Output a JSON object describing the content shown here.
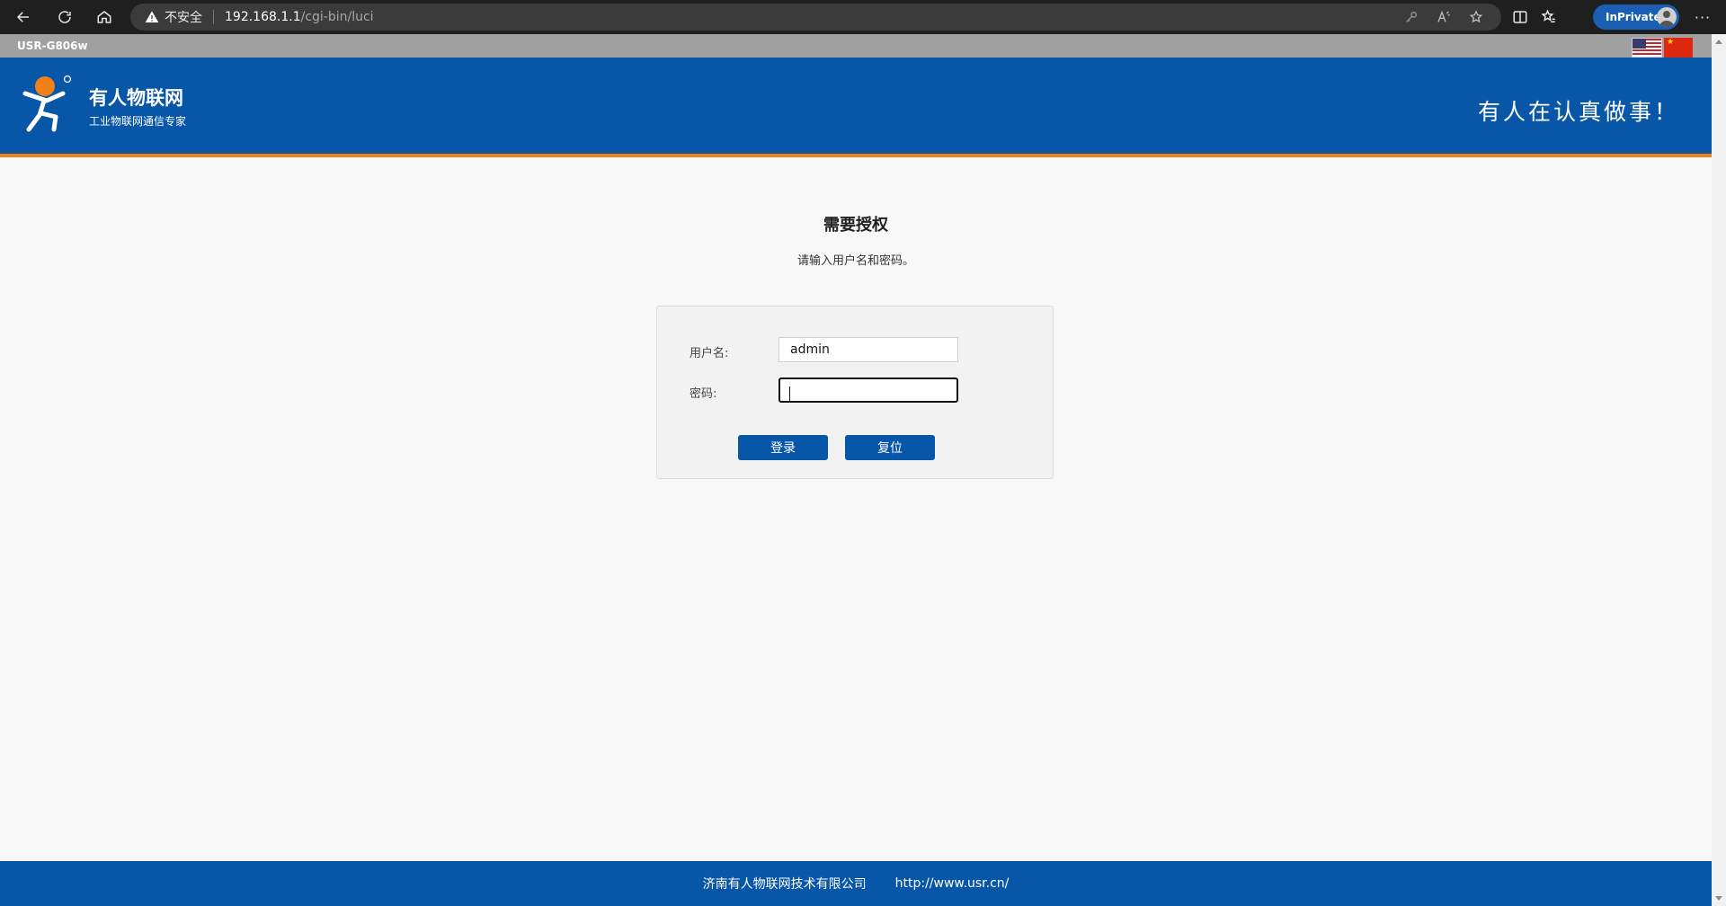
{
  "browser": {
    "security_label": "不安全",
    "url_host": "192.168.1.1",
    "url_path": "/cgi-bin/luci",
    "inprivate_label": "InPrivate",
    "more_label": "···",
    "icons": [
      "back-icon",
      "refresh-icon",
      "home-icon",
      "warning-icon",
      "key-icon",
      "read-aloud-icon",
      "favorite-add-icon",
      "split-screen-icon",
      "favorites-icon"
    ]
  },
  "page": {
    "device_name": "USR-G806w",
    "header": {
      "brand_name": "有人物联网",
      "brand_sub": "工业物联网通信专家",
      "slogan": "有人在认真做事！"
    },
    "auth": {
      "title": "需要授权",
      "description": "请输入用户名和密码。"
    },
    "form": {
      "username_label": "用户名:",
      "username_value": "admin",
      "password_label": "密码:",
      "password_value": "",
      "login_label": "登录",
      "reset_label": "复位"
    },
    "footer": {
      "company": "济南有人物联网技术有限公司",
      "url": "http://www.usr.cn/"
    }
  },
  "colors": {
    "brand_blue": "#0756a8",
    "accent_orange": "#f18117",
    "page_bg": "#f8f8f8",
    "strip_gray": "#a0a0a0"
  }
}
